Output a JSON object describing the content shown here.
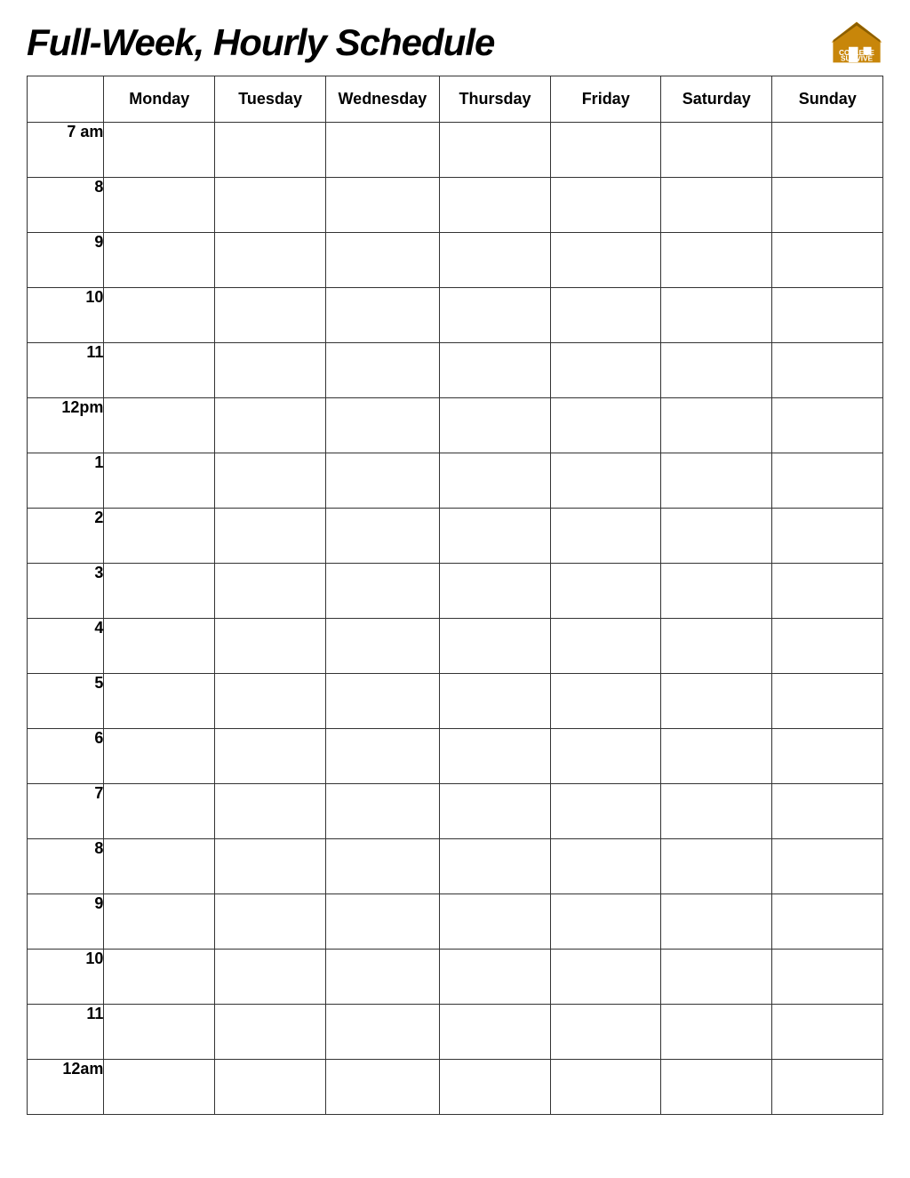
{
  "title": "Full-Week, Hourly Schedule",
  "logo": {
    "line1": "COLLEGE",
    "line2": "SURVIVE"
  },
  "days": [
    "Monday",
    "Tuesday",
    "Wednesday",
    "Thursday",
    "Friday",
    "Saturday",
    "Sunday"
  ],
  "time_slots": [
    "7 am",
    "8",
    "9",
    "10",
    "11",
    "12pm",
    "1",
    "2",
    "3",
    "4",
    "5",
    "6",
    "7",
    "8",
    "9",
    "10",
    "11",
    "12am"
  ]
}
